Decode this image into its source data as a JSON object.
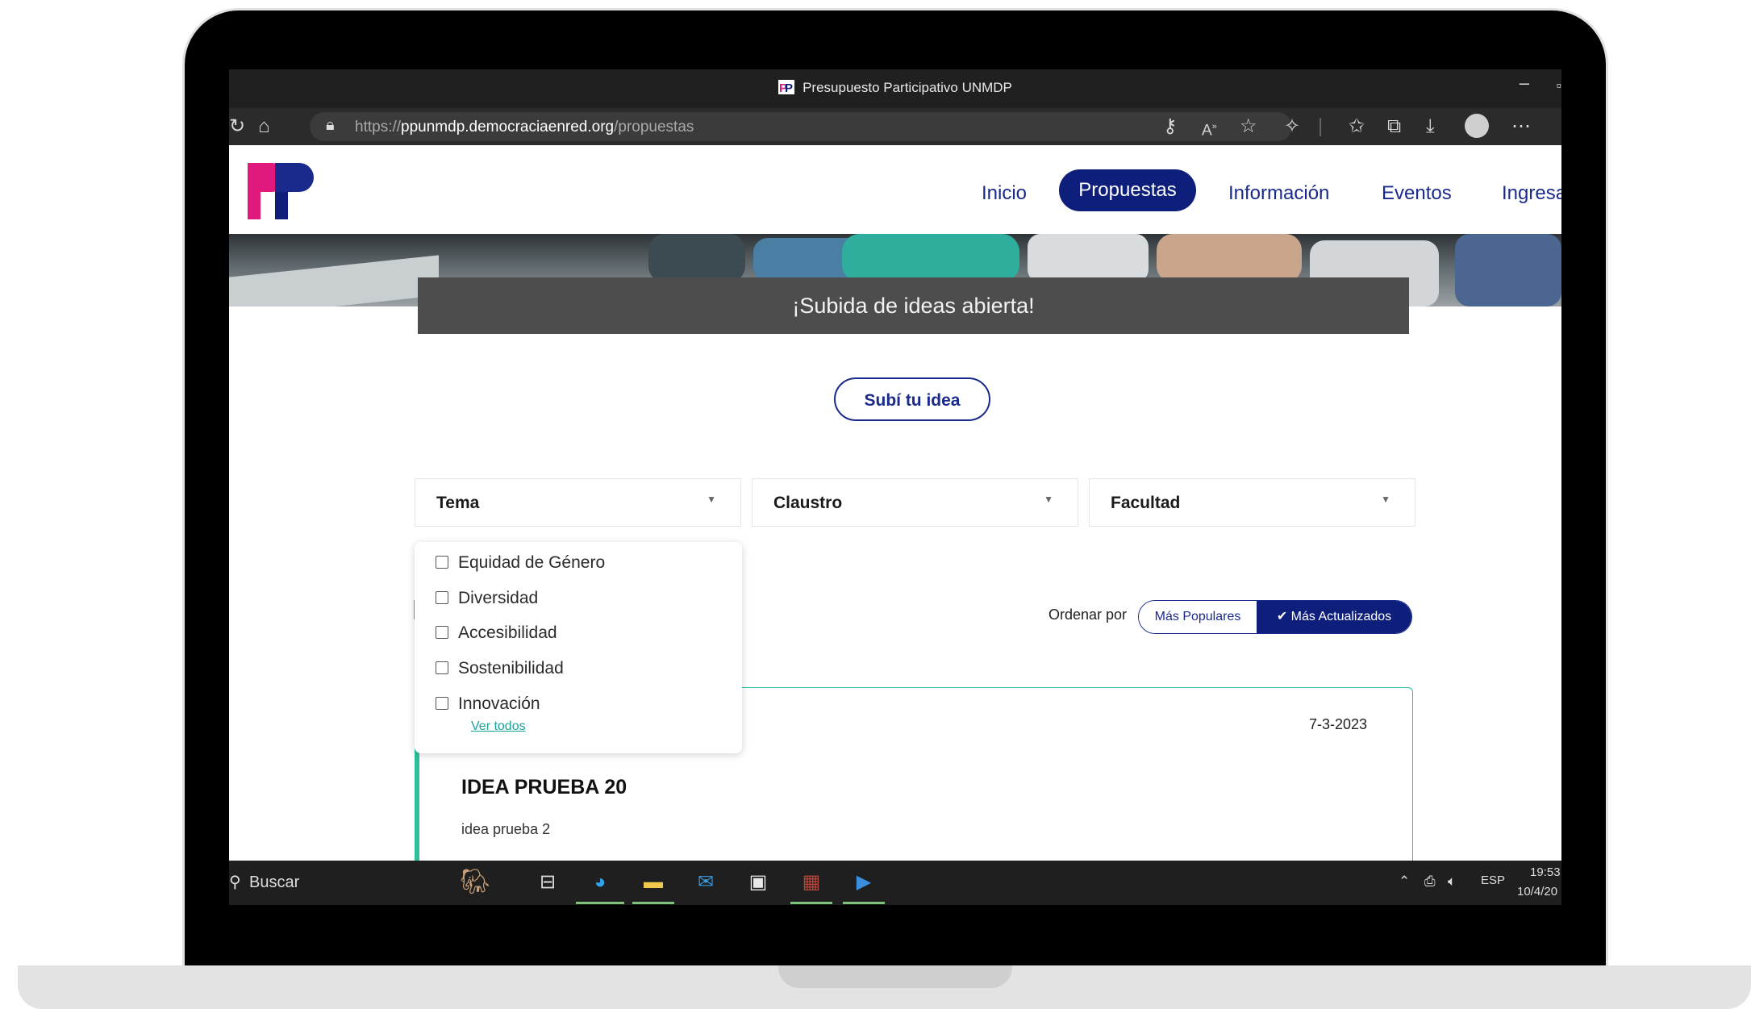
{
  "browser": {
    "window_title": "Presupuesto Participativo UNMDP",
    "url_prefix": "https://",
    "url_domain": "ppunmdp.democraciaenred.org",
    "url_path": "/propuestas"
  },
  "site": {
    "logo_text": "PP",
    "nav": [
      {
        "label": "Inicio",
        "active": false
      },
      {
        "label": "Propuestas",
        "active": true
      },
      {
        "label": "Información",
        "active": false
      },
      {
        "label": "Eventos",
        "active": false
      },
      {
        "label": "Ingresa",
        "active": false
      }
    ],
    "banner_text": "¡Subida de ideas abierta!",
    "submit_button": "Subí tu idea"
  },
  "filters": [
    {
      "label": "Tema",
      "arrow": "▼"
    },
    {
      "label": "Claustro",
      "arrow": "▼"
    },
    {
      "label": "Facultad",
      "arrow": "▼"
    }
  ],
  "tema_dropdown": {
    "options": [
      "Equidad de Género",
      "Diversidad",
      "Accesibilidad",
      "Sostenibilidad",
      "Innovación"
    ],
    "ver_todos": "Ver todos"
  },
  "sort": {
    "label": "Ordenar por",
    "options": [
      {
        "label": "Más Populares",
        "selected": false
      },
      {
        "label": "Más Actualizados",
        "selected": true
      }
    ]
  },
  "idea_card": {
    "date": "7-3-2023",
    "title": "IDEA PRUEBA 20",
    "description": "idea prueba 2"
  },
  "taskbar": {
    "search_label": "Buscar",
    "apps": [
      "elephant-widget",
      "task-view",
      "edge",
      "file-explorer",
      "mail",
      "store",
      "winrar",
      "media-player"
    ],
    "tray_language": "ESP",
    "time": "19:53",
    "date": "10/4/20"
  },
  "colors": {
    "brand_navy": "#0d1f7a",
    "brand_magenta": "#e0197d",
    "accent_teal": "#2fbf9b"
  }
}
